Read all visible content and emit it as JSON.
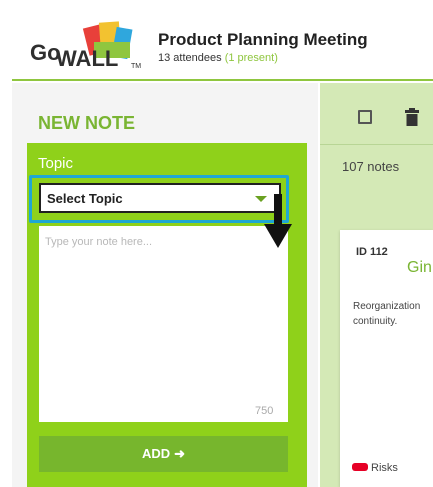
{
  "header": {
    "meeting_title": "Product Planning Meeting",
    "attendees_text": "13 attendees",
    "present_text": "(1 present)",
    "logo": {
      "text_go": "Go",
      "text_wall": "WALL",
      "trademark": "TM"
    }
  },
  "new_note": {
    "title": "NEW NOTE",
    "topic_label": "Topic",
    "topic_select_value": "Select Topic",
    "note_placeholder": "Type your note here...",
    "char_count": "750",
    "add_label": "ADD",
    "add_icon": "arrow-right-icon"
  },
  "notes_panel": {
    "notes_count": "107 notes",
    "toolbar_icons": [
      "checkbox-icon",
      "trash-icon"
    ],
    "card": {
      "id_text": "ID 112",
      "title_partial": "Gin",
      "text": "Reorganization continuity.",
      "tag_label": "Risks",
      "tag_color": "#e60026"
    }
  },
  "colors": {
    "accent_green": "#8fd11a",
    "button_green": "#77b62d",
    "title_green": "#7ab533",
    "highlight_blue": "#1fa7d4",
    "panel_green": "#d4e9b6"
  }
}
